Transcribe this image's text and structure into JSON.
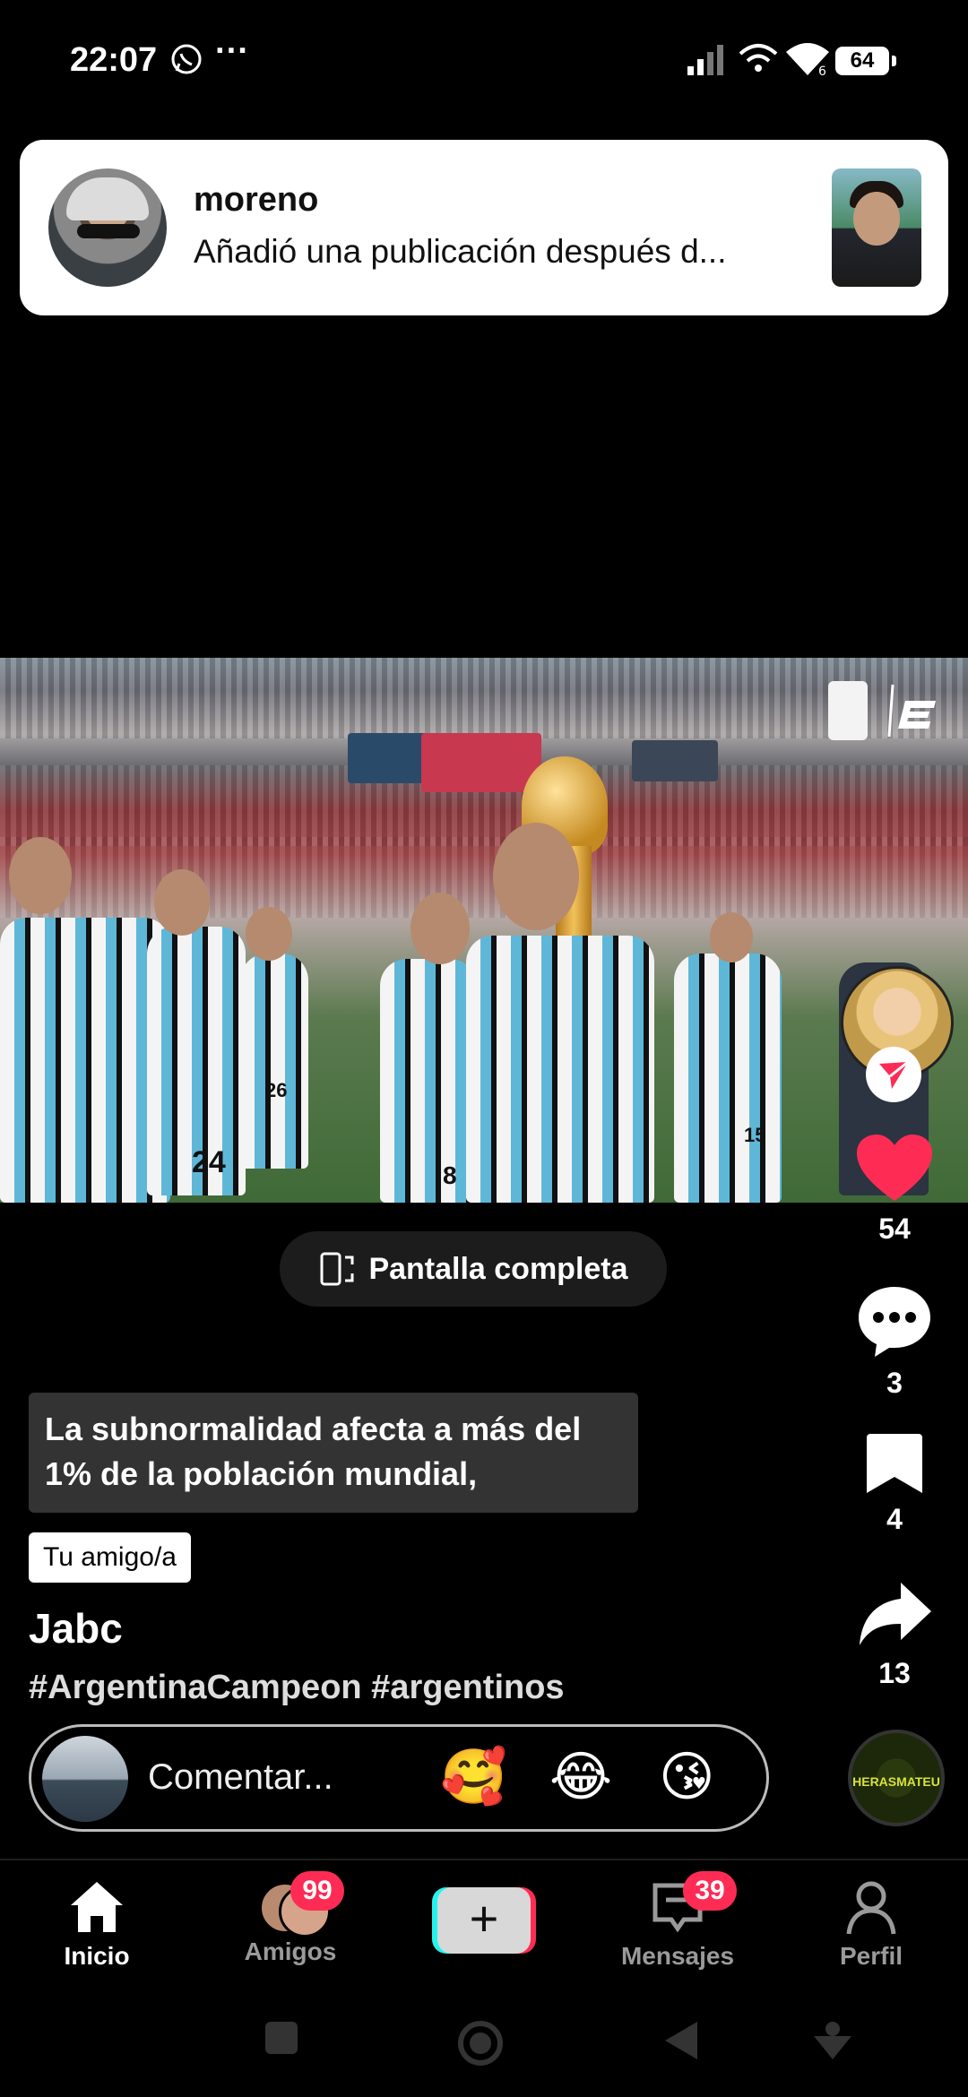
{
  "status_bar": {
    "time": "22:07",
    "more": "···",
    "battery": "64",
    "icons": [
      "whatsapp-icon",
      "signal-icon",
      "wifi-call-icon",
      "wifi-icon",
      "battery-icon"
    ]
  },
  "notification": {
    "title": "moreno",
    "text": "Añadió una publicación después d..."
  },
  "video": {
    "jersey_numbers": [
      "24",
      "26",
      "8",
      "15"
    ],
    "fullscreen_label": "Pantalla completa"
  },
  "actions": {
    "likes": "54",
    "comments": "3",
    "bookmarks": "4",
    "shares": "13",
    "like_color": "#fe2c55"
  },
  "post": {
    "caption": "La subnormalidad afecta a más del 1% de la población mundial,",
    "friend_tag": "Tu amigo/a",
    "author": "Jabc",
    "hashtags": "#ArgentinaCampeon #argentinos"
  },
  "comment_bar": {
    "placeholder": "Comentar...",
    "emojis": [
      "🥰",
      "😂",
      "😘"
    ]
  },
  "music": {
    "label": "HERASMATEU"
  },
  "bottom_nav": {
    "items": [
      {
        "label": "Inicio"
      },
      {
        "label": "Amigos",
        "badge": "99"
      },
      {
        "label": "+"
      },
      {
        "label": "Mensajes",
        "badge": "39"
      },
      {
        "label": "Perfil"
      }
    ]
  },
  "colors": {
    "accent": "#fe2c55",
    "cyan": "#25f4ee",
    "background": "#000000"
  }
}
